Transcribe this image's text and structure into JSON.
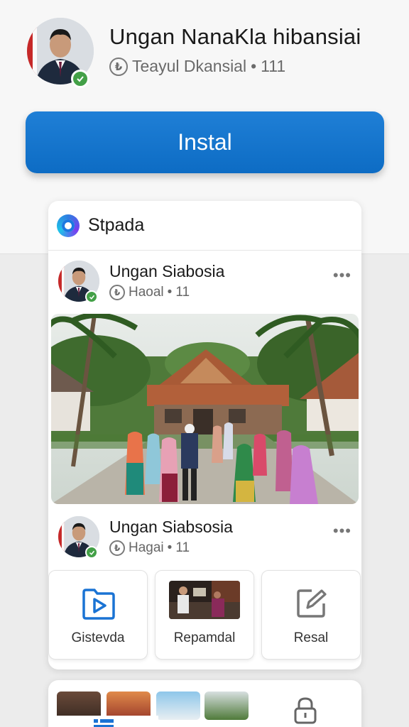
{
  "profile": {
    "name": "Ungan NanaKla hibansiai",
    "subtitle_text": "Teayul Dkansial",
    "subtitle_count": "111",
    "subtitle_icon": "currency-circle-icon",
    "verified_icon": "check-icon"
  },
  "install_button": {
    "label": "Instal",
    "color": "#1f7fd6"
  },
  "card": {
    "title": "Stpada",
    "app_icon": "ring-logo-icon",
    "posts": [
      {
        "name": "Ungan Siabosia",
        "meta": "Haoal",
        "count": "11",
        "more": "•••"
      },
      {
        "name": "Ungan Siabsosia",
        "meta": "Hagai",
        "count": "11",
        "more": "•••"
      }
    ],
    "tiles": [
      {
        "label": "Gistevda",
        "icon": "play-folder-icon",
        "accent": "#1a73d4"
      },
      {
        "label": "Repamdal",
        "icon": "video-thumbnail"
      },
      {
        "label": "Resal",
        "icon": "edit-square-icon"
      }
    ]
  },
  "bottom_nav": {
    "left_icon": "list-icon",
    "right_icon": "lock-icon",
    "accent": "#1a73d4"
  },
  "separator": "•"
}
